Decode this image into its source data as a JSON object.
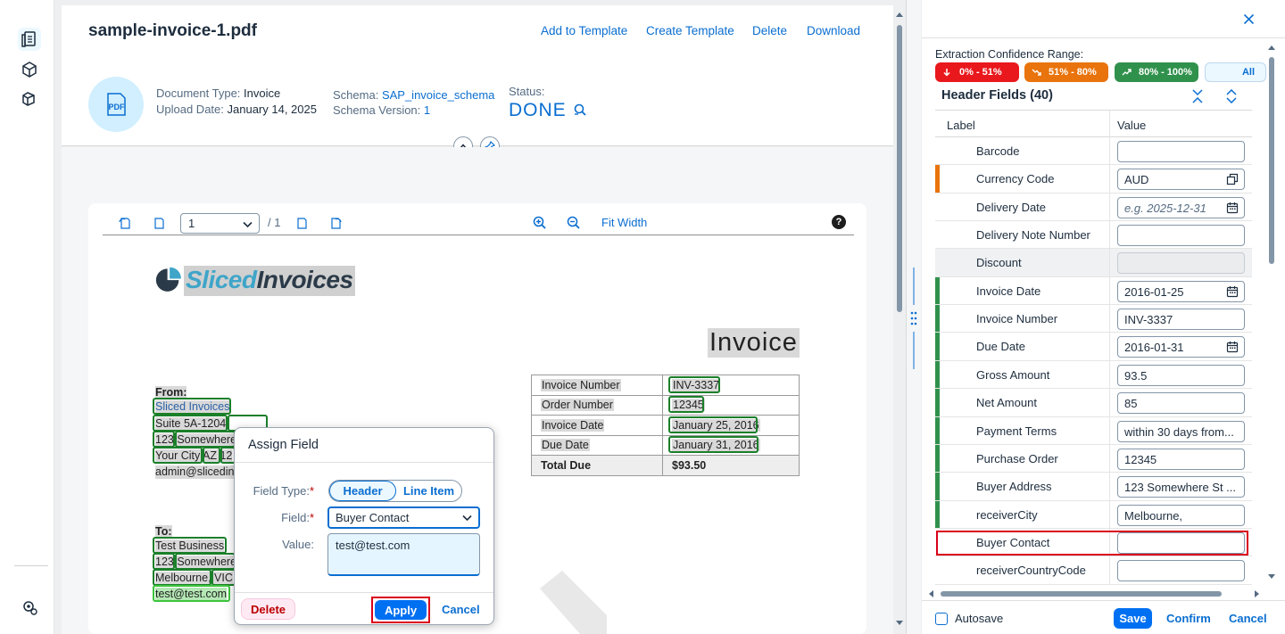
{
  "nav": {
    "items": [
      "documents-icon",
      "schema-icon",
      "template-icon"
    ],
    "bottom": "settings-icon"
  },
  "header": {
    "filename": "sample-invoice-1.pdf",
    "actions": [
      "Add to Template",
      "Create Template",
      "Delete",
      "Download"
    ],
    "pdf_badge": "PDF",
    "doc_type_label": "Document Type:",
    "doc_type_value": "Invoice",
    "upload_label": "Upload Date:",
    "upload_value": "January 14, 2025",
    "schema_label": "Schema:",
    "schema_value": "SAP_invoice_schema",
    "schema_version_label": "Schema Version:",
    "schema_version_value": "1",
    "status_label": "Status:",
    "status_value": "DONE"
  },
  "pdf_toolbar": {
    "page": "1",
    "total": "/ 1",
    "fit_width": "Fit Width"
  },
  "invoice_doc": {
    "logo_part1": "Sliced",
    "logo_part2": "Invoices",
    "title": "Invoice",
    "from_label": "From:",
    "from_lines": [
      "Sliced Invoices",
      "Suite 5A-1204",
      "123 Somewhere",
      "Your City AZ 12",
      "admin@slicedin"
    ],
    "to_label": "To:",
    "to_lines": [
      "Test Business",
      "123 Somewhere",
      "Melbourne, VIC",
      "test@test.com"
    ],
    "table": [
      [
        "Invoice Number",
        "INV-3337"
      ],
      [
        "Order Number",
        "12345"
      ],
      [
        "Invoice Date",
        "January 25, 2016"
      ],
      [
        "Due Date",
        "January 31, 2016"
      ],
      [
        "Total Due",
        "$93.50"
      ]
    ]
  },
  "assign_popup": {
    "title": "Assign Field",
    "field_type_label": "Field Type:",
    "field_type_options": [
      "Header",
      "Line Item"
    ],
    "field_label": "Field:",
    "field_value": "Buyer Contact",
    "value_label": "Value:",
    "value": "test@test.com",
    "delete": "Delete",
    "apply": "Apply",
    "cancel": "Cancel"
  },
  "right_panel": {
    "confidence_label": "Extraction Confidence Range:",
    "chips": [
      {
        "label": "0% - 51%",
        "color": "#e9181c"
      },
      {
        "label": "51% - 80%",
        "color": "#e9730c"
      },
      {
        "label": "80% - 100%",
        "color": "#30914c"
      },
      {
        "label": "All",
        "color": "#ebf8ff"
      }
    ],
    "section_title": "Header Fields (40)",
    "col_label": "Label",
    "col_value": "Value",
    "fields": [
      {
        "label": "Barcode",
        "value": "",
        "bar": "",
        "icon": ""
      },
      {
        "label": "Currency Code",
        "value": "AUD",
        "bar": "#e9730c",
        "icon": "copy"
      },
      {
        "label": "Delivery Date",
        "value": "e.g. 2025-12-31",
        "bar": "",
        "icon": "calendar",
        "placeholder": true
      },
      {
        "label": "Delivery Note Number",
        "value": "",
        "bar": "",
        "icon": ""
      },
      {
        "label": "Discount",
        "value": "",
        "bar": "",
        "icon": "",
        "disabled": true
      },
      {
        "label": "Invoice Date",
        "value": "2016-01-25",
        "bar": "#30914c",
        "icon": "calendar"
      },
      {
        "label": "Invoice Number",
        "value": "INV-3337",
        "bar": "#30914c",
        "icon": ""
      },
      {
        "label": "Due Date",
        "value": "2016-01-31",
        "bar": "#30914c",
        "icon": "calendar"
      },
      {
        "label": "Gross Amount",
        "value": "93.5",
        "bar": "#30914c",
        "icon": ""
      },
      {
        "label": "Net Amount",
        "value": "85",
        "bar": "#30914c",
        "icon": ""
      },
      {
        "label": "Payment Terms",
        "value": "within 30 days from...",
        "bar": "#30914c",
        "icon": ""
      },
      {
        "label": "Purchase Order",
        "value": "12345",
        "bar": "#30914c",
        "icon": ""
      },
      {
        "label": "Buyer Address",
        "value": "123 Somewhere St ...",
        "bar": "#30914c",
        "icon": ""
      },
      {
        "label": "receiverCity",
        "value": "Melbourne,",
        "bar": "#30914c",
        "icon": ""
      },
      {
        "label": "Buyer Contact",
        "value": "",
        "bar": "",
        "icon": ""
      },
      {
        "label": "receiverCountryCode",
        "value": "",
        "bar": "",
        "icon": ""
      }
    ],
    "autosave": "Autosave",
    "save": "Save",
    "confirm": "Confirm",
    "cancel": "Cancel"
  }
}
